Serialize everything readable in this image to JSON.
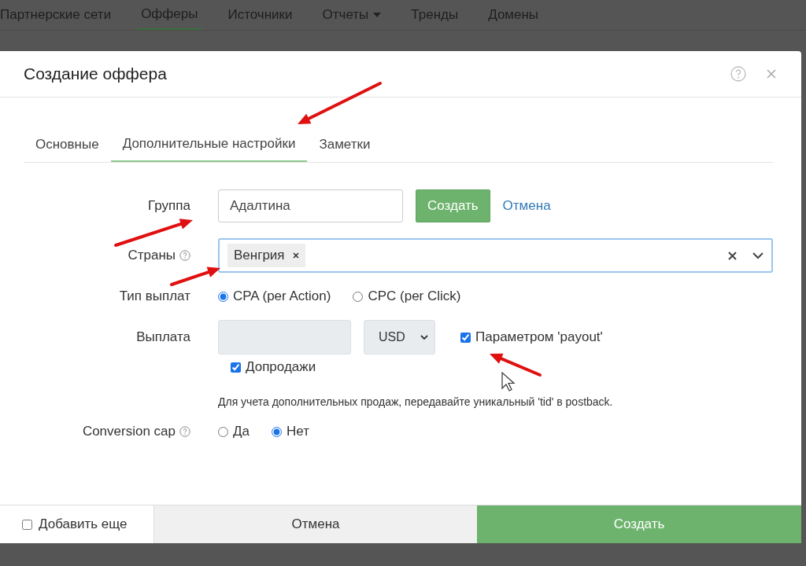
{
  "nav": [
    {
      "label": "Партнерские сети",
      "selected": false,
      "dropdown": false
    },
    {
      "label": "Офферы",
      "selected": true,
      "dropdown": false
    },
    {
      "label": "Источники",
      "selected": false,
      "dropdown": false
    },
    {
      "label": "Отчеты",
      "selected": false,
      "dropdown": true
    },
    {
      "label": "Тренды",
      "selected": false,
      "dropdown": false
    },
    {
      "label": "Домены",
      "selected": false,
      "dropdown": false
    }
  ],
  "dialog": {
    "title": "Создание оффера",
    "tabs": [
      {
        "label": "Основные",
        "selected": false
      },
      {
        "label": "Дополнительные настройки",
        "selected": true
      },
      {
        "label": "Заметки",
        "selected": false
      }
    ],
    "group": {
      "label": "Группа",
      "value": "Адалтина",
      "create": "Создать",
      "cancel": "Отмена"
    },
    "countries": {
      "label": "Страны",
      "tags": [
        {
          "label": "Венгрия"
        }
      ]
    },
    "payout_type": {
      "label": "Тип выплат",
      "options": [
        {
          "label": "CPA (per Action)",
          "selected": true
        },
        {
          "label": "CPC (per Click)",
          "selected": false
        }
      ]
    },
    "payout": {
      "label": "Выплата",
      "disabled": true,
      "currency": "USD",
      "by_param": {
        "label": "Параметром 'payout'",
        "checked": true
      },
      "upsell": {
        "label": "Допродажи",
        "checked": true
      },
      "hint": "Для учета дополнительных продаж, передавайте уникальный 'tid' в postback."
    },
    "conversion_cap": {
      "label": "Conversion cap",
      "options": [
        {
          "label": "Да",
          "selected": false
        },
        {
          "label": "Нет",
          "selected": true
        }
      ]
    },
    "footer": {
      "add_more": {
        "label": "Добавить еще",
        "checked": false
      },
      "cancel": "Отмена",
      "submit": "Создать"
    }
  }
}
